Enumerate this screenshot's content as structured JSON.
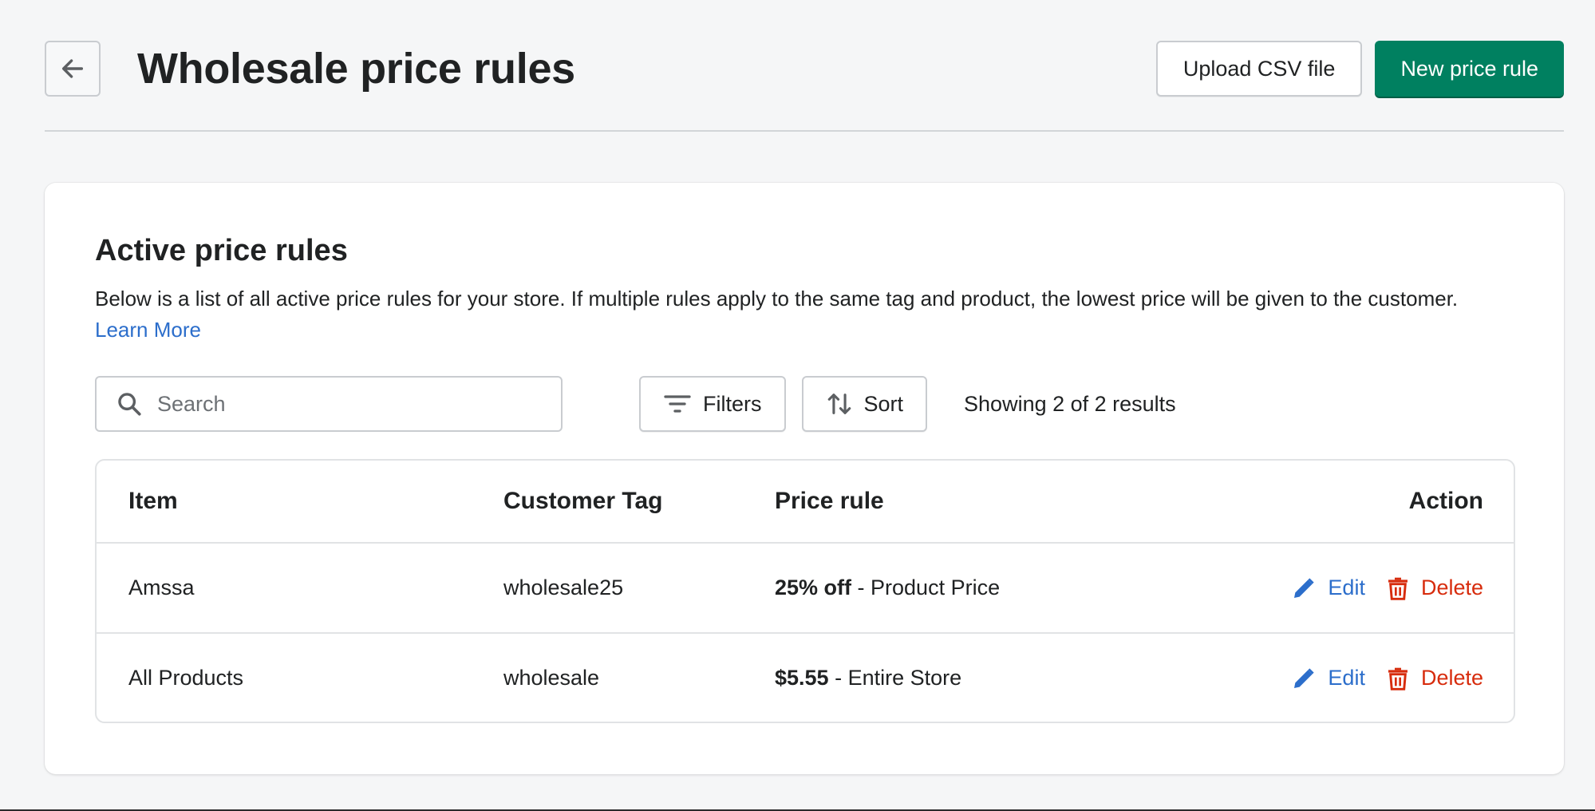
{
  "header": {
    "title": "Wholesale price rules",
    "upload_label": "Upload CSV file",
    "new_rule_label": "New price rule"
  },
  "card": {
    "title": "Active price rules",
    "description": "Below is a list of all active price rules for your store. If multiple rules apply to the same tag and product, the lowest price will be given to the customer.",
    "learn_more": "Learn More"
  },
  "toolbar": {
    "search_placeholder": "Search",
    "filters_label": "Filters",
    "sort_label": "Sort",
    "results_text": "Showing 2 of 2 results"
  },
  "table": {
    "columns": [
      "Item",
      "Customer Tag",
      "Price rule",
      "Action"
    ],
    "rows": [
      {
        "item": "Amssa",
        "tag": "wholesale25",
        "rule_value": "25% off",
        "rule_scope": " - Product Price",
        "edit": "Edit",
        "delete": "Delete"
      },
      {
        "item": "All Products",
        "tag": "wholesale",
        "rule_value": "$5.55",
        "rule_scope": " - Entire Store",
        "edit": "Edit",
        "delete": "Delete"
      }
    ]
  },
  "colors": {
    "primary": "#008060",
    "link": "#2c6ecb",
    "destructive": "#d72c0d",
    "background": "#f5f6f7"
  },
  "icons": [
    "arrow-left-icon",
    "search-icon",
    "filter-icon",
    "sort-icon",
    "pencil-icon",
    "trash-icon"
  ]
}
